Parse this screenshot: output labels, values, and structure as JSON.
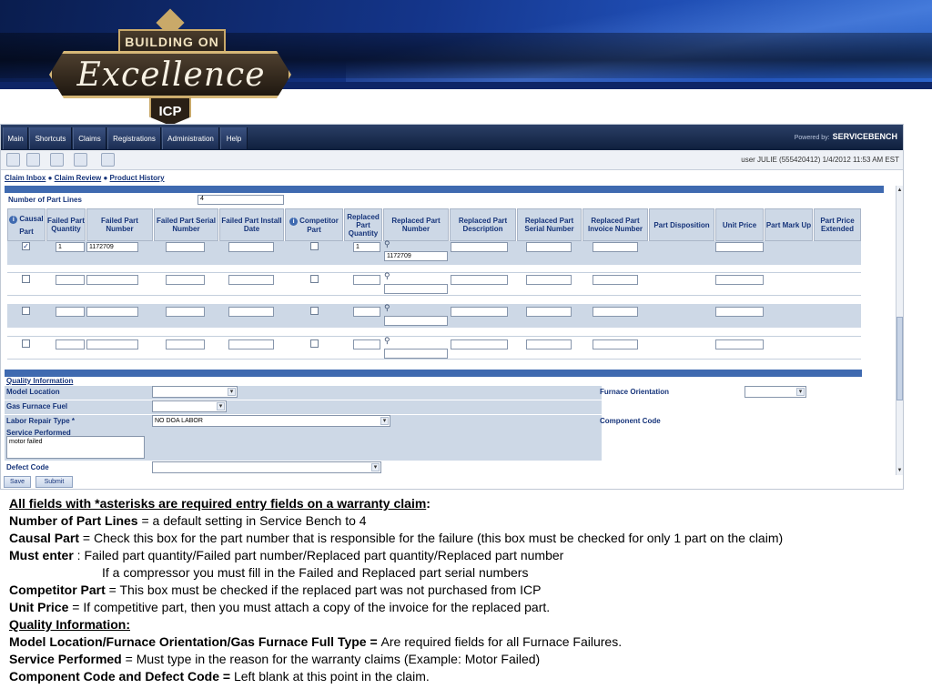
{
  "logo": {
    "top_text": "BUILDING ON",
    "script_text": "Excellence",
    "bottom_text": "ICP"
  },
  "menu": {
    "items": [
      "Main",
      "Shortcuts",
      "Claims",
      "Registrations",
      "Administration",
      "Help"
    ],
    "powered_by": "Powered by:",
    "brand": "SERVICEBENCH"
  },
  "toolbar": {
    "user_info": "user JULIE (555420412) 1/4/2012 11:53 AM EST"
  },
  "breadcrumb": {
    "items": [
      "Claim Inbox",
      "Claim Review",
      "Product History"
    ],
    "separator": "●"
  },
  "part_lines": {
    "label": "Number of Part Lines",
    "value": "4",
    "columns": [
      "Causal Part",
      "Failed Part Quantity",
      "Failed Part Number",
      "Failed Part Serial Number",
      "Failed Part Install Date",
      "Competitor Part",
      "Replaced Part Quantity",
      "Replaced Part Number",
      "Replaced Part Description",
      "Replaced Part Serial Number",
      "Replaced Part Invoice Number",
      "Part Disposition",
      "Unit Price",
      "Part Mark Up",
      "Part Price Extended"
    ],
    "header_parts": {
      "causal": "Causal",
      "causal_sub": "Part",
      "competitor": "Competitor",
      "competitor_sub": "Part"
    },
    "rows": [
      {
        "causal": "✓",
        "failed_qty": "1",
        "failed_number": "1172709",
        "replaced_qty": "1",
        "replaced_number": "1172709"
      },
      {
        "causal": "",
        "failed_qty": "",
        "failed_number": "",
        "replaced_qty": "",
        "replaced_number": ""
      },
      {
        "causal": "",
        "failed_qty": "",
        "failed_number": "",
        "replaced_qty": "",
        "replaced_number": ""
      },
      {
        "causal": "",
        "failed_qty": "",
        "failed_number": "",
        "replaced_qty": "",
        "replaced_number": ""
      }
    ]
  },
  "quality": {
    "title": "Quality Information",
    "model_location": "Model Location",
    "gas_furnace_fuel": "Gas Furnace Fuel",
    "labor_repair_type": "Labor Repair Type *",
    "labor_repair_value": "NO DOA LABOR",
    "service_performed": "Service Performed",
    "service_performed_value": "motor failed",
    "defect_code": "Defect Code",
    "furnace_orientation": "Furnace Orientation",
    "component_code": "Component Code"
  },
  "buttons": {
    "save": "Save",
    "submit": "Submit"
  },
  "notes": {
    "line1": "All fields with *asterisks are required entry fields on a warranty claim",
    "line1_colon": ":",
    "l2_b": "Number of Part Lines",
    "l2": " = a default setting in Service Bench to 4",
    "l3_b": "Causal Part",
    "l3": " =  Check this box for the part number that is responsible for the failure (this box must be checked for only 1 part on the claim)",
    "l4_b": "Must enter",
    "l4": " : Failed part quantity/Failed part number/Replaced part quantity/Replaced part number",
    "l5": "If a compressor you must fill in the Failed and Replaced part serial numbers",
    "l6_b": "Competitor Part",
    "l6": " = This box must be checked if the replaced part was not purchased from ICP",
    "l7_b": "Unit Price",
    "l7": " = If competitive part, then you must attach a copy of the invoice for the replaced part.",
    "l8": "Quality Information:",
    "l9_b": "Model Location/Furnace Orientation/Gas Furnace Full Type = ",
    "l9": " Are required fields for all Furnace Failures.",
    "l10_b": "Service Performed",
    "l10": " =  Must type in the reason for the warranty claims (Example: Motor Failed)",
    "l11_b": "Component Code and Defect Code  =",
    "l11": " Left blank at this point in the claim."
  },
  "colors": {
    "banner_dark": "#0a1d4e",
    "banner_light": "#2b63c9",
    "menubar": "#1b2d52",
    "section_bar": "#3f6ab0",
    "row_shade": "#cdd8e6",
    "label_text": "#16347a"
  }
}
